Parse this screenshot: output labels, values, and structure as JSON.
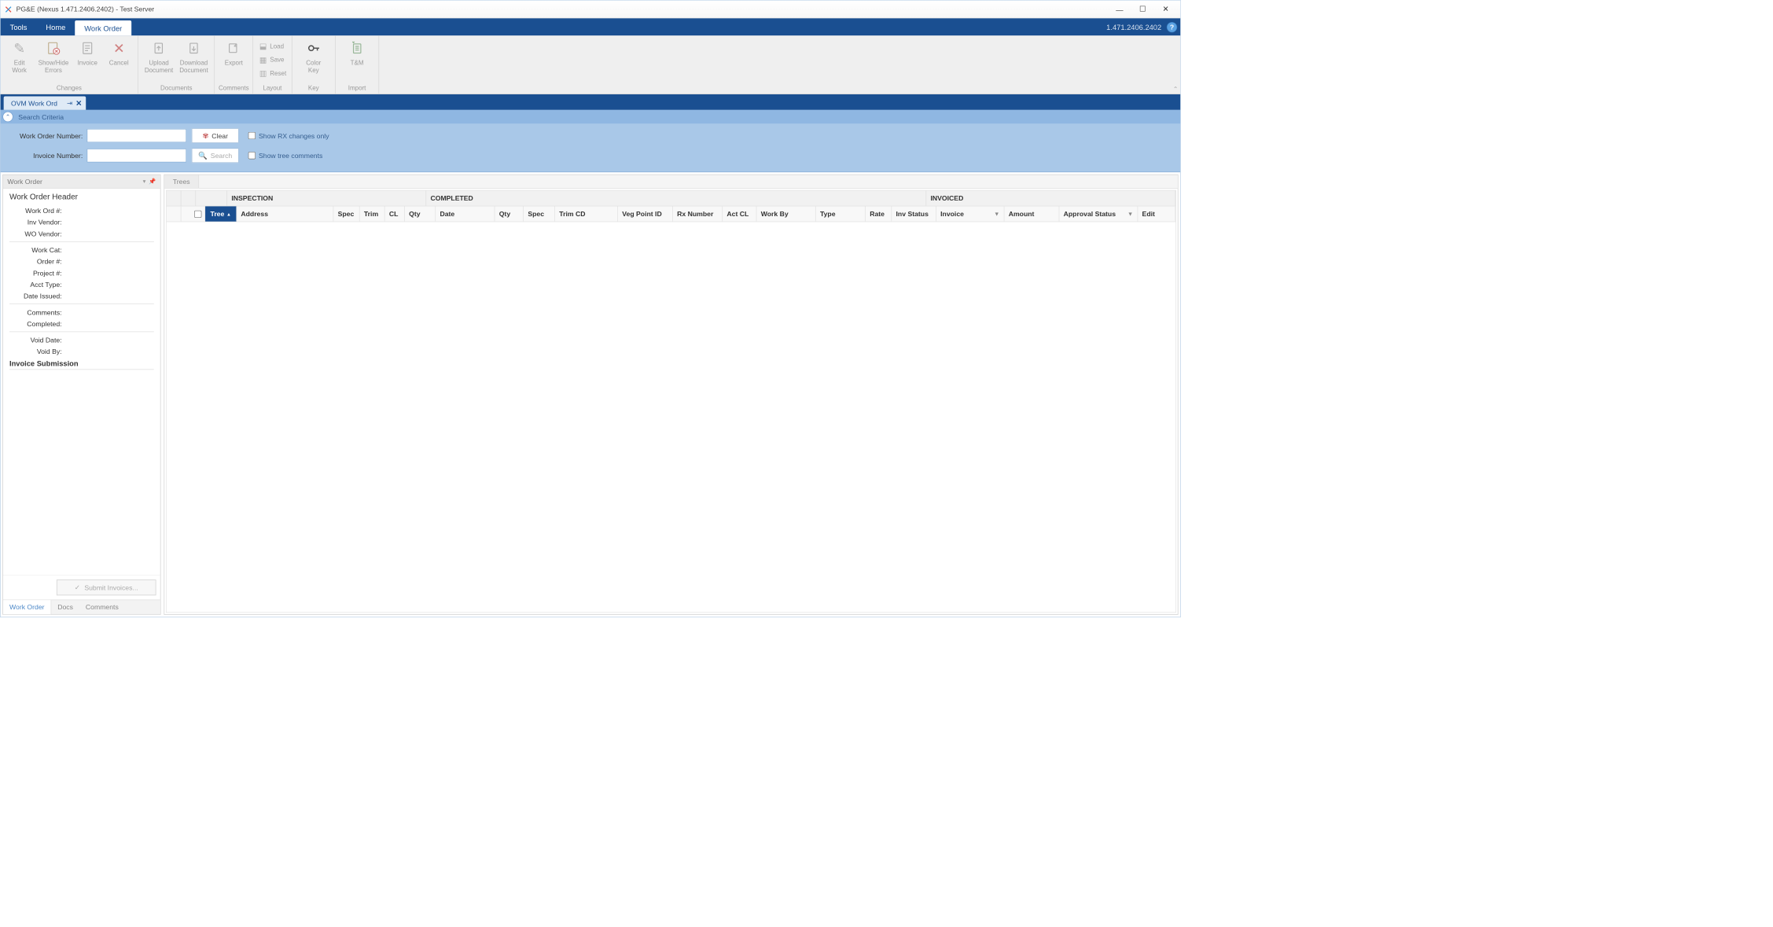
{
  "window": {
    "title": "PG&E (Nexus 1.471.2406.2402) - Test Server",
    "version_label": "1.471.2406.2402"
  },
  "menu": {
    "tools": "Tools",
    "home": "Home",
    "work_order": "Work Order"
  },
  "ribbon": {
    "changes": {
      "edit_work": "Edit\nWork",
      "show_hide_errors": "Show/Hide\nErrors",
      "invoice": "Invoice",
      "cancel": "Cancel",
      "group": "Changes"
    },
    "documents": {
      "upload": "Upload\nDocument",
      "download": "Download\nDocument",
      "group": "Documents"
    },
    "comments": {
      "export": "Export",
      "group": "Comments"
    },
    "layout": {
      "load": "Load",
      "save": "Save",
      "reset": "Reset",
      "group": "Layout"
    },
    "key": {
      "color_key": "Color\nKey",
      "group": "Key"
    },
    "import": {
      "tm": "T&M",
      "group": "Import"
    }
  },
  "doc_tab": {
    "label": "OVM Work Ord"
  },
  "search": {
    "header": "Search Criteria",
    "work_order_number_label": "Work Order Number:",
    "invoice_number_label": "Invoice Number:",
    "clear_button": "Clear",
    "search_button": "Search",
    "show_rx": "Show RX changes only",
    "show_tree_comments": "Show tree comments",
    "work_order_number_value": "",
    "invoice_number_value": ""
  },
  "left_pane": {
    "panel_title": "Work Order",
    "header_title": "Work Order Header",
    "fields": {
      "work_ord": "Work Ord #:",
      "inv_vendor": "Inv Vendor:",
      "wo_vendor": "WO Vendor:",
      "work_cat": "Work Cat:",
      "order": "Order #:",
      "project": "Project #:",
      "acct_type": "Acct Type:",
      "date_issued": "Date Issued:",
      "comments": "Comments:",
      "completed": "Completed:",
      "void_date": "Void Date:",
      "void_by": "Void By:"
    },
    "invoice_submission": "Invoice Submission",
    "submit_button": "Submit Invoices...",
    "tabs": {
      "work_order": "Work Order",
      "docs": "Docs",
      "comments": "Comments"
    }
  },
  "grid": {
    "tab": "Trees",
    "sections": {
      "inspection": "INSPECTION",
      "completed": "COMPLETED",
      "invoiced": "INVOICED"
    },
    "cols": {
      "tree": "Tree",
      "address": "Address",
      "spec": "Spec",
      "trim": "Trim",
      "cl": "CL",
      "qty": "Qty",
      "date": "Date",
      "qty2": "Qty",
      "spec2": "Spec",
      "trim_cd": "Trim CD",
      "veg_point_id": "Veg Point ID",
      "rx_number": "Rx Number",
      "act_cl": "Act CL",
      "work_by": "Work By",
      "type": "Type",
      "rate": "Rate",
      "inv_status": "Inv Status",
      "invoice": "Invoice",
      "amount": "Amount",
      "approval_status": "Approval Status",
      "edit": "Edit"
    }
  }
}
